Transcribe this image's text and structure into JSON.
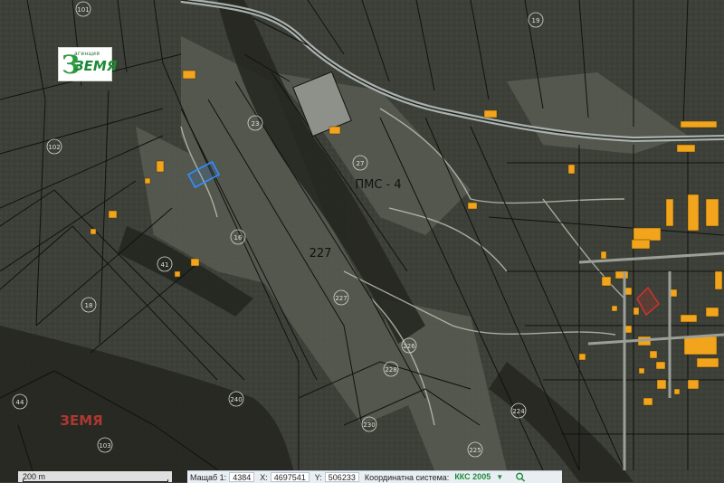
{
  "logo": {
    "top_text": "агенция",
    "main_text": "ЗЕМЯ",
    "mark": "З"
  },
  "map_labels": {
    "region": "ПМС - 4",
    "main_parcel": "227",
    "watermark": "ЗЕМЯ",
    "parcels": [
      "101",
      "102",
      "23",
      "19",
      "16",
      "27",
      "41",
      "18",
      "226",
      "228",
      "224",
      "230",
      "240",
      "225",
      "44",
      "103",
      "227"
    ]
  },
  "scale": {
    "label": "200 m"
  },
  "toolbar": {
    "scale_label": "Мащаб 1:",
    "scale_value": "4384",
    "x_label": "X:",
    "x_value": "4697541",
    "y_label": "Y:",
    "y_value": "506233",
    "system_label": "Координатна система:",
    "system_value": "ККС 2005",
    "dropdown_icon": "caret-down-icon",
    "search_icon": "search-icon"
  },
  "colors": {
    "terrain": "#3d4038",
    "road": "#a9b1ae",
    "building": "#f2a51c",
    "parcel_line": "#111111",
    "selection": "#2e8fff",
    "highlight": "#d8322d"
  }
}
